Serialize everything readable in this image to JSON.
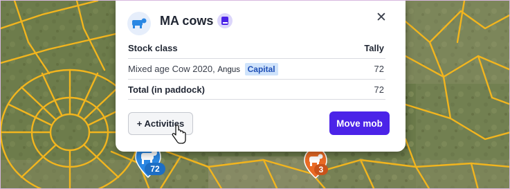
{
  "mob": {
    "name": "MA cows",
    "mob_icon": "cow-icon",
    "book_icon": "book-icon",
    "close_icon": "close-icon",
    "close_glyph": "✕"
  },
  "table": {
    "headers": {
      "stock_class": "Stock class",
      "tally": "Tally"
    },
    "rows": [
      {
        "stock_class": "Mixed age Cow 2020,",
        "breed": "Angus",
        "tag": "Capital",
        "tally": "72"
      }
    ],
    "total": {
      "label": "Total (in paddock)",
      "tally": "72"
    }
  },
  "buttons": {
    "activities": "+ Activities",
    "move_mob": "Move mob"
  },
  "map_markers": [
    {
      "icon": "cow-icon",
      "count": "72",
      "color": "#2a87e3"
    },
    {
      "icon": "cow-icon",
      "count": "3",
      "color": "#ea6b25"
    }
  ],
  "colors": {
    "primary": "#4b23e8",
    "paddock_lines": "#f2b51e",
    "badge_bg": "#cfe3fb",
    "badge_text": "#1f4fb6"
  }
}
